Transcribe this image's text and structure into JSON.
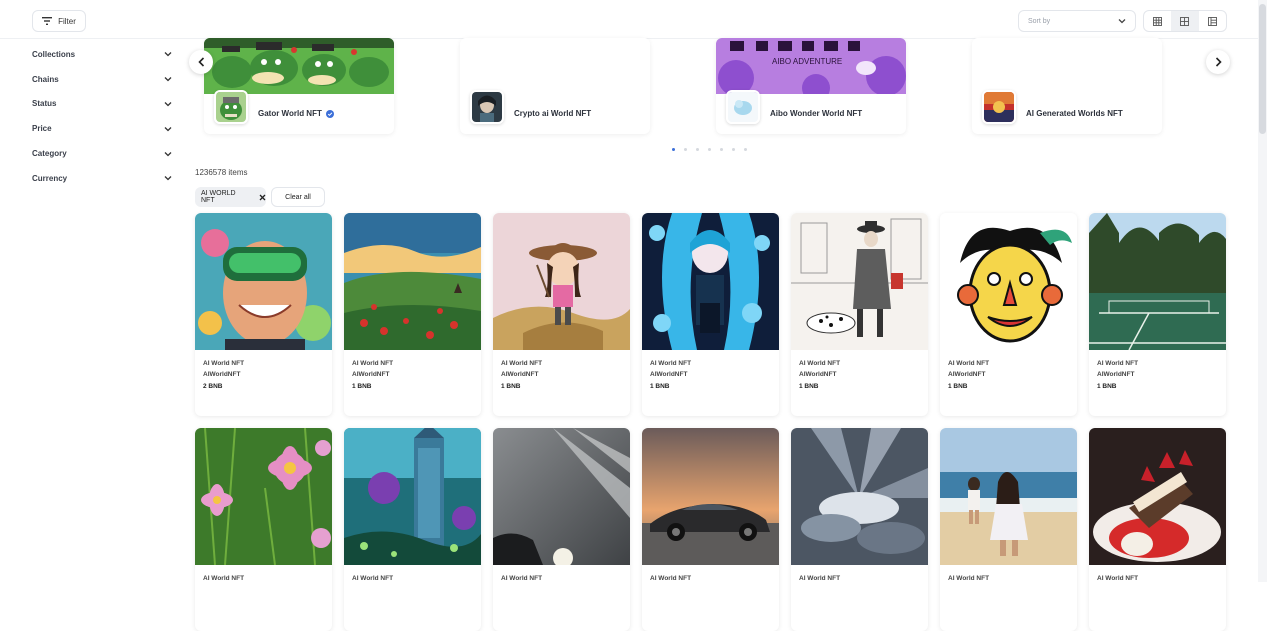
{
  "toolbar": {
    "filter_label": "Filter",
    "sort_placeholder": "Sort by",
    "view_modes": [
      "grid-small-icon",
      "grid-large-icon",
      "list-icon"
    ],
    "active_view": 1
  },
  "sidebar": {
    "items": [
      {
        "label": "Collections"
      },
      {
        "label": "Chains"
      },
      {
        "label": "Status"
      },
      {
        "label": "Price"
      },
      {
        "label": "Category"
      },
      {
        "label": "Currency"
      }
    ]
  },
  "carousel": {
    "collections": [
      {
        "name": "Gator World NFT",
        "verified": true
      },
      {
        "name": "Crypto ai World NFT",
        "verified": false
      },
      {
        "name": "Aibo Wonder World NFT",
        "verified": false
      },
      {
        "name": "AI Generated Worlds NFT",
        "verified": false
      }
    ],
    "banner_text": "AIBO ADVENTURE",
    "page_count": 7,
    "active_page": 0
  },
  "results": {
    "count_label": "1236578 items",
    "active_filter": "AI WORLD NFT",
    "clear_label": "Clear all"
  },
  "items": [
    {
      "name": "AI World NFT",
      "collection": "AIWorldNFT",
      "price": "2 BNB",
      "image": "vr-smiling-man"
    },
    {
      "name": "AI World NFT",
      "collection": "AIWorldNFT",
      "price": "1 BNB",
      "image": "flower-hill-landscape"
    },
    {
      "name": "AI World NFT",
      "collection": "AIWorldNFT",
      "price": "1 BNB",
      "image": "girl-with-hat"
    },
    {
      "name": "AI World NFT",
      "collection": "AIWorldNFT",
      "price": "1 BNB",
      "image": "blue-anime-girl"
    },
    {
      "name": "AI World NFT",
      "collection": "AIWorldNFT",
      "price": "1 BNB",
      "image": "sketch-woman-dalmatian"
    },
    {
      "name": "AI World NFT",
      "collection": "AIWorldNFT",
      "price": "1 BNB",
      "image": "jester-face"
    },
    {
      "name": "AI World NFT",
      "collection": "AIWorldNFT",
      "price": "1 BNB",
      "image": "tennis-court"
    },
    {
      "name": "AI World NFT",
      "collection": "",
      "price": "",
      "image": "pink-cosmos-flowers"
    },
    {
      "name": "AI World NFT",
      "collection": "",
      "price": "",
      "image": "fantasy-tower"
    },
    {
      "name": "AI World NFT",
      "collection": "",
      "price": "",
      "image": "sky-sun-rays"
    },
    {
      "name": "AI World NFT",
      "collection": "",
      "price": "",
      "image": "sports-car-sunset"
    },
    {
      "name": "AI World NFT",
      "collection": "",
      "price": "",
      "image": "cloud-sunburst"
    },
    {
      "name": "AI World NFT",
      "collection": "",
      "price": "",
      "image": "girls-on-beach"
    },
    {
      "name": "AI World NFT",
      "collection": "",
      "price": "",
      "image": "strawberry-dessert"
    }
  ],
  "colors": {
    "accent": "#3c6fd8",
    "border": "#e3e6eb",
    "chip_bg": "#eef0f3"
  }
}
